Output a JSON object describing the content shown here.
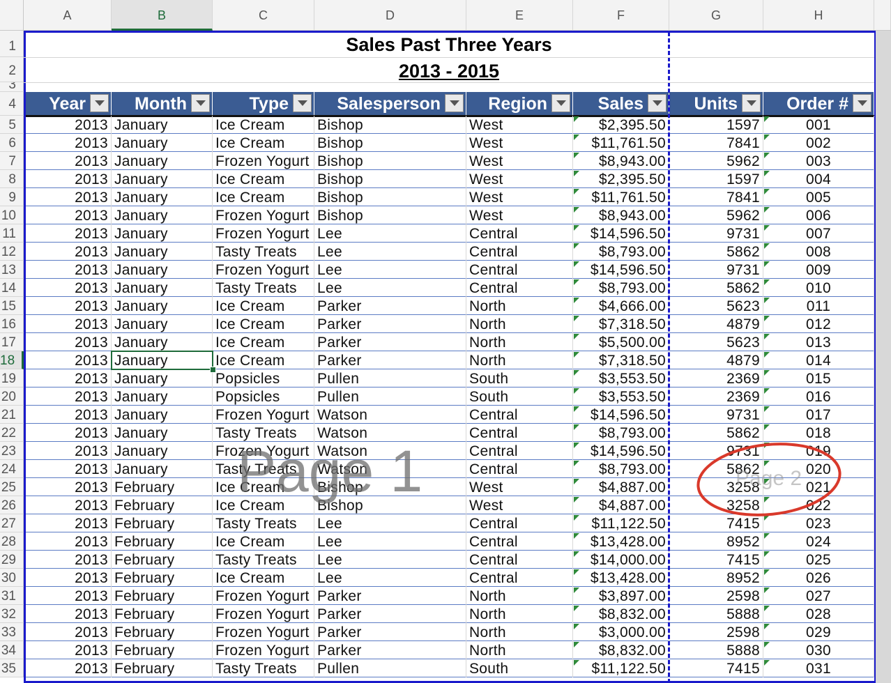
{
  "columns": [
    "A",
    "B",
    "C",
    "D",
    "E",
    "F",
    "G",
    "H"
  ],
  "row_numbers": [
    "1",
    "2",
    "3",
    "4",
    "5",
    "6",
    "7",
    "8",
    "9",
    "10",
    "11",
    "12",
    "13",
    "14",
    "15",
    "16",
    "17",
    "18",
    "19",
    "20",
    "21",
    "22",
    "23",
    "24",
    "25",
    "26",
    "27",
    "28",
    "29",
    "30",
    "31",
    "32",
    "33",
    "34",
    "35"
  ],
  "selected_column": "B",
  "selected_row": "18",
  "title": "Sales Past Three Years",
  "subtitle": "2013 - 2015",
  "headers": [
    "Year",
    "Month",
    "Type",
    "Salesperson",
    "Region",
    "Sales",
    "Units",
    "Order #"
  ],
  "rows": [
    [
      "2013",
      "January",
      "Ice Cream",
      "Bishop",
      "West",
      "$2,395.50",
      "1597",
      "001"
    ],
    [
      "2013",
      "January",
      "Ice Cream",
      "Bishop",
      "West",
      "$11,761.50",
      "7841",
      "002"
    ],
    [
      "2013",
      "January",
      "Frozen Yogurt",
      "Bishop",
      "West",
      "$8,943.00",
      "5962",
      "003"
    ],
    [
      "2013",
      "January",
      "Ice Cream",
      "Bishop",
      "West",
      "$2,395.50",
      "1597",
      "004"
    ],
    [
      "2013",
      "January",
      "Ice Cream",
      "Bishop",
      "West",
      "$11,761.50",
      "7841",
      "005"
    ],
    [
      "2013",
      "January",
      "Frozen Yogurt",
      "Bishop",
      "West",
      "$8,943.00",
      "5962",
      "006"
    ],
    [
      "2013",
      "January",
      "Frozen Yogurt",
      "Lee",
      "Central",
      "$14,596.50",
      "9731",
      "007"
    ],
    [
      "2013",
      "January",
      "Tasty Treats",
      "Lee",
      "Central",
      "$8,793.00",
      "5862",
      "008"
    ],
    [
      "2013",
      "January",
      "Frozen Yogurt",
      "Lee",
      "Central",
      "$14,596.50",
      "9731",
      "009"
    ],
    [
      "2013",
      "January",
      "Tasty Treats",
      "Lee",
      "Central",
      "$8,793.00",
      "5862",
      "010"
    ],
    [
      "2013",
      "January",
      "Ice Cream",
      "Parker",
      "North",
      "$4,666.00",
      "5623",
      "011"
    ],
    [
      "2013",
      "January",
      "Ice Cream",
      "Parker",
      "North",
      "$7,318.50",
      "4879",
      "012"
    ],
    [
      "2013",
      "January",
      "Ice Cream",
      "Parker",
      "North",
      "$5,500.00",
      "5623",
      "013"
    ],
    [
      "2013",
      "January",
      "Ice Cream",
      "Parker",
      "North",
      "$7,318.50",
      "4879",
      "014"
    ],
    [
      "2013",
      "January",
      "Popsicles",
      "Pullen",
      "South",
      "$3,553.50",
      "2369",
      "015"
    ],
    [
      "2013",
      "January",
      "Popsicles",
      "Pullen",
      "South",
      "$3,553.50",
      "2369",
      "016"
    ],
    [
      "2013",
      "January",
      "Frozen Yogurt",
      "Watson",
      "Central",
      "$14,596.50",
      "9731",
      "017"
    ],
    [
      "2013",
      "January",
      "Tasty Treats",
      "Watson",
      "Central",
      "$8,793.00",
      "5862",
      "018"
    ],
    [
      "2013",
      "January",
      "Frozen Yogurt",
      "Watson",
      "Central",
      "$14,596.50",
      "9731",
      "019"
    ],
    [
      "2013",
      "January",
      "Tasty Treats",
      "Watson",
      "Central",
      "$8,793.00",
      "5862",
      "020"
    ],
    [
      "2013",
      "February",
      "Ice Cream",
      "Bishop",
      "West",
      "$4,887.00",
      "3258",
      "021"
    ],
    [
      "2013",
      "February",
      "Ice Cream",
      "Bishop",
      "West",
      "$4,887.00",
      "3258",
      "022"
    ],
    [
      "2013",
      "February",
      "Tasty Treats",
      "Lee",
      "Central",
      "$11,122.50",
      "7415",
      "023"
    ],
    [
      "2013",
      "February",
      "Ice Cream",
      "Lee",
      "Central",
      "$13,428.00",
      "8952",
      "024"
    ],
    [
      "2013",
      "February",
      "Tasty Treats",
      "Lee",
      "Central",
      "$14,000.00",
      "7415",
      "025"
    ],
    [
      "2013",
      "February",
      "Ice Cream",
      "Lee",
      "Central",
      "$13,428.00",
      "8952",
      "026"
    ],
    [
      "2013",
      "February",
      "Frozen Yogurt",
      "Parker",
      "North",
      "$3,897.00",
      "2598",
      "027"
    ],
    [
      "2013",
      "February",
      "Frozen Yogurt",
      "Parker",
      "North",
      "$8,832.00",
      "5888",
      "028"
    ],
    [
      "2013",
      "February",
      "Frozen Yogurt",
      "Parker",
      "North",
      "$3,000.00",
      "2598",
      "029"
    ],
    [
      "2013",
      "February",
      "Frozen Yogurt",
      "Parker",
      "North",
      "$8,832.00",
      "5888",
      "030"
    ],
    [
      "2013",
      "February",
      "Tasty Treats",
      "Pullen",
      "South",
      "$11,122.50",
      "7415",
      "031"
    ]
  ],
  "watermarks": {
    "page1": "Page 1",
    "page2": "Page 2"
  },
  "annotation_color": "#d9392b",
  "header_fill": "#3b5c93",
  "page_break_color": "#1a1acb"
}
